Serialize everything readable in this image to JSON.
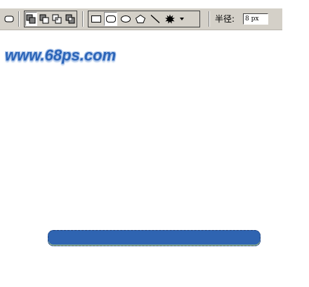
{
  "toolbar": {
    "preset_icon": "rounded-rect-preset-icon",
    "combine_modes": [
      {
        "name": "add-to-shape-area-icon"
      },
      {
        "name": "subtract-from-shape-area-icon"
      },
      {
        "name": "intersect-shape-areas-icon"
      },
      {
        "name": "exclude-overlapping-areas-icon"
      }
    ],
    "shape_tools": [
      {
        "name": "rectangle-tool-icon",
        "selected": false
      },
      {
        "name": "rounded-rectangle-tool-icon",
        "selected": true
      },
      {
        "name": "ellipse-tool-icon",
        "selected": false
      },
      {
        "name": "polygon-tool-icon",
        "selected": false
      },
      {
        "name": "line-tool-icon",
        "selected": false
      },
      {
        "name": "custom-shape-tool-icon",
        "selected": false
      },
      {
        "name": "dropdown-arrow-icon",
        "selected": false
      }
    ],
    "radius_label": "半径:",
    "radius_value": "8 px"
  },
  "watermark": {
    "text": "www.68ps.com"
  },
  "colors": {
    "toolbar_bg": "#d4d0c8",
    "shape_fill": "#2f64b1",
    "watermark": "#2c65b8"
  }
}
